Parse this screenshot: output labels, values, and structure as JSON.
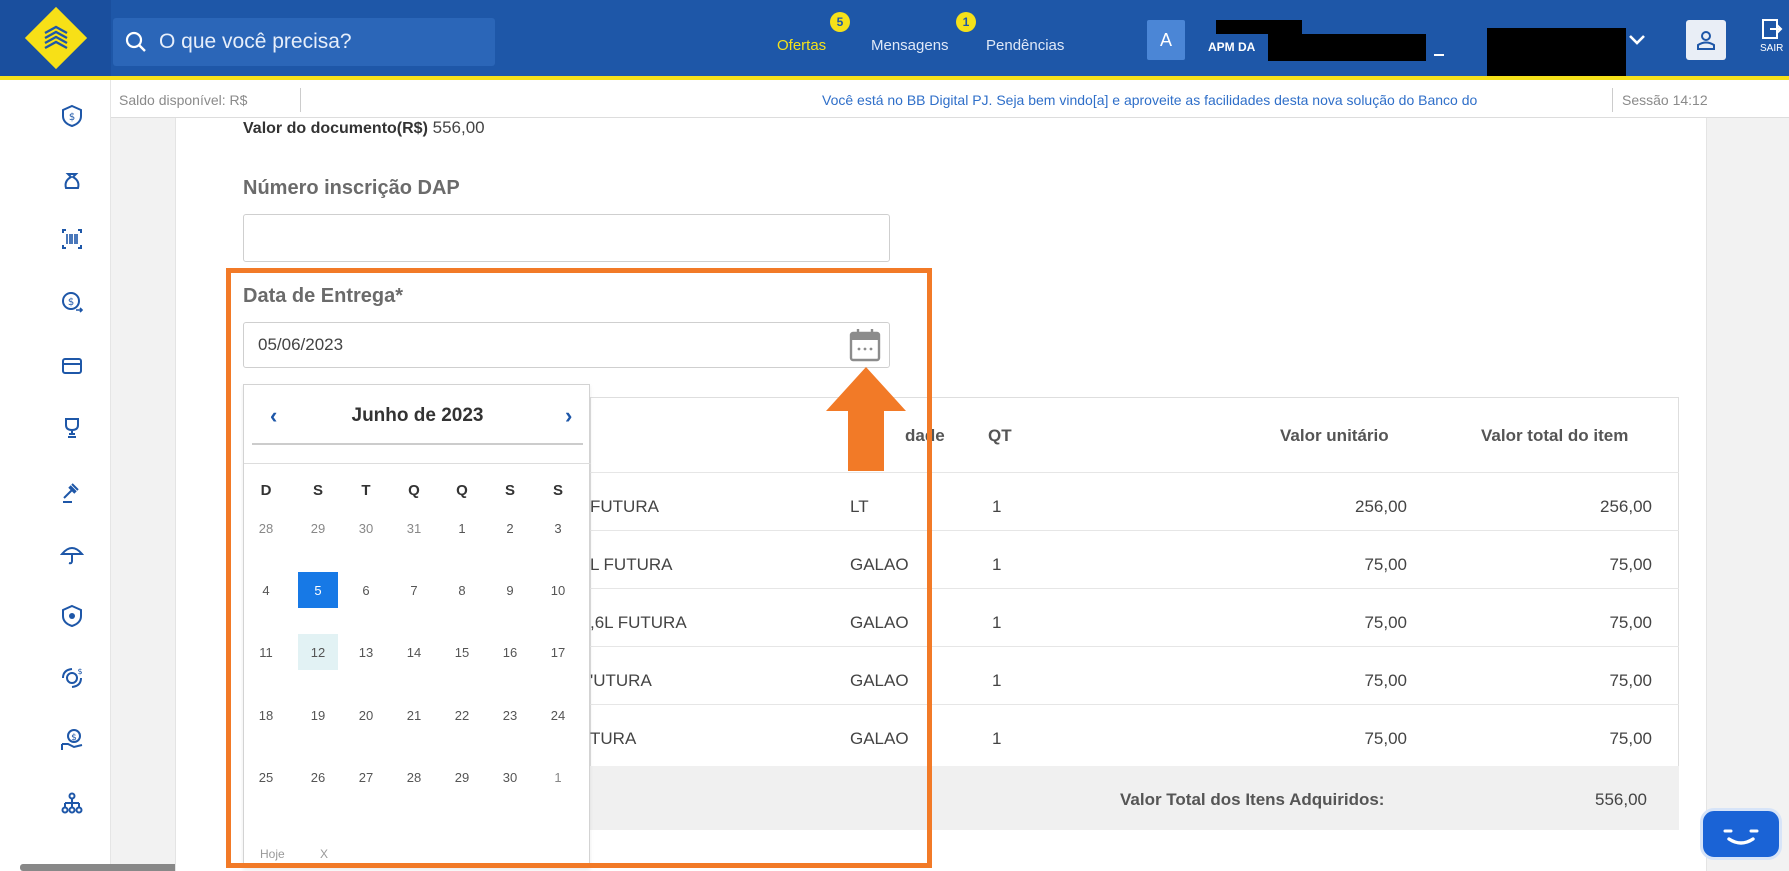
{
  "header": {
    "search_placeholder": "O que você precisa?",
    "nav": [
      {
        "label": "Ofertas",
        "badge": "5"
      },
      {
        "label": "Mensagens",
        "badge": "1"
      },
      {
        "label": "Pendências",
        "badge": ""
      }
    ],
    "account_initial": "A",
    "account_name": "APM DA",
    "exit_label": "SAIR"
  },
  "statusbar": {
    "saldo": "Saldo disponível: R$",
    "message": "Você está no BB Digital PJ. Seja bem vindo[a] e aproveite as facilidades desta nova solução do Banco do",
    "session": "Sessão 14:12"
  },
  "form": {
    "doc_value_label": "Valor do documento(R$)",
    "doc_value": "556,00",
    "dap_label": "Número inscrição DAP",
    "dap_value": "",
    "date_label": "Data de Entrega*",
    "date_value": "05/06/2023"
  },
  "calendar": {
    "title": "Junho de 2023",
    "prev": "‹",
    "next": "›",
    "weekdays": [
      "D",
      "S",
      "T",
      "Q",
      "Q",
      "S",
      "S"
    ],
    "weeks": [
      [
        "28",
        "29",
        "30",
        "31",
        "1",
        "2",
        "3"
      ],
      [
        "4",
        "5",
        "6",
        "7",
        "8",
        "9",
        "10"
      ],
      [
        "11",
        "12",
        "13",
        "14",
        "15",
        "16",
        "17"
      ],
      [
        "18",
        "19",
        "20",
        "21",
        "22",
        "23",
        "24"
      ],
      [
        "25",
        "26",
        "27",
        "28",
        "29",
        "30",
        "1"
      ]
    ],
    "selected_day": "5",
    "today_day": "12",
    "today_label": "Hoje",
    "clear_label": "X"
  },
  "table": {
    "headers": {
      "unit": "dade",
      "qt": "QT",
      "unit_price": "Valor unitário",
      "total": "Valor total do item"
    },
    "rows": [
      {
        "product": "FUTURA",
        "unit": "LT",
        "qt": "1",
        "unit_price": "256,00",
        "total": "256,00"
      },
      {
        "product": "L FUTURA",
        "unit": "GALAO",
        "qt": "1",
        "unit_price": "75,00",
        "total": "75,00"
      },
      {
        "product": ",6L FUTURA",
        "unit": "GALAO",
        "qt": "1",
        "unit_price": "75,00",
        "total": "75,00"
      },
      {
        "product": "'UTURA",
        "unit": "GALAO",
        "qt": "1",
        "unit_price": "75,00",
        "total": "75,00"
      },
      {
        "product": "TURA",
        "unit": "GALAO",
        "qt": "1",
        "unit_price": "75,00",
        "total": "75,00"
      }
    ],
    "total_label": "Valor Total dos Itens Adquiridos:",
    "total_value": "556,00"
  },
  "colors": {
    "brand_blue": "#1e57a8",
    "brand_yellow": "#f5e11a",
    "highlight_orange": "#f27a27",
    "selected_day": "#1779e6"
  }
}
